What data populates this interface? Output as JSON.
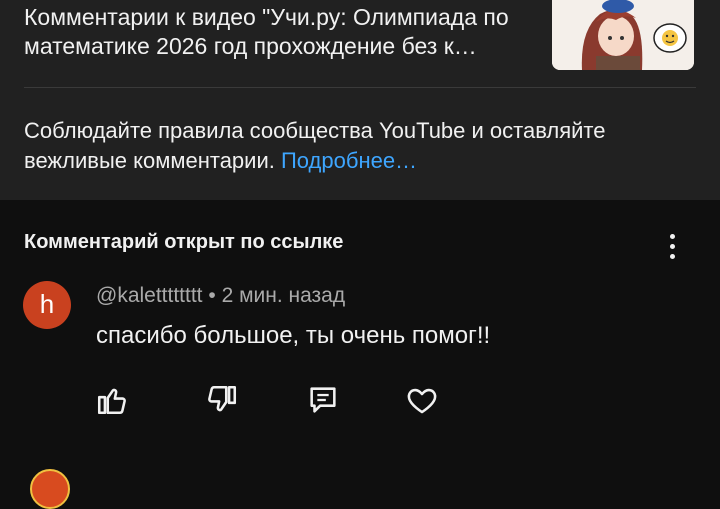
{
  "header": {
    "video_title": "Комментарии к видео \"Учи.ру: Олимпиада по математике 2026 год прохождение без к…",
    "thumbnail": "anime-girl-thumbnail"
  },
  "guidelines": {
    "text": "Соблюдайте правила сообщества YouTube и оставляйте вежливые комментарии. ",
    "link": "Подробнее…"
  },
  "linked_comment": {
    "header": "Комментарий открыт по ссылке",
    "avatar_letter": "h",
    "author": "@kaletttttttt",
    "separator": " • ",
    "time": "2 мин. назад",
    "text": "спасибо большое, ты очень помог!!",
    "avatar_color": "#c9411f"
  },
  "actions": {
    "icons": [
      "like-icon",
      "dislike-icon",
      "reply-icon",
      "heart-icon"
    ]
  },
  "colors": {
    "panel": "#212121",
    "background": "#0f0f0f",
    "link": "#3ea6ff",
    "meta": "#aaaaaa"
  }
}
